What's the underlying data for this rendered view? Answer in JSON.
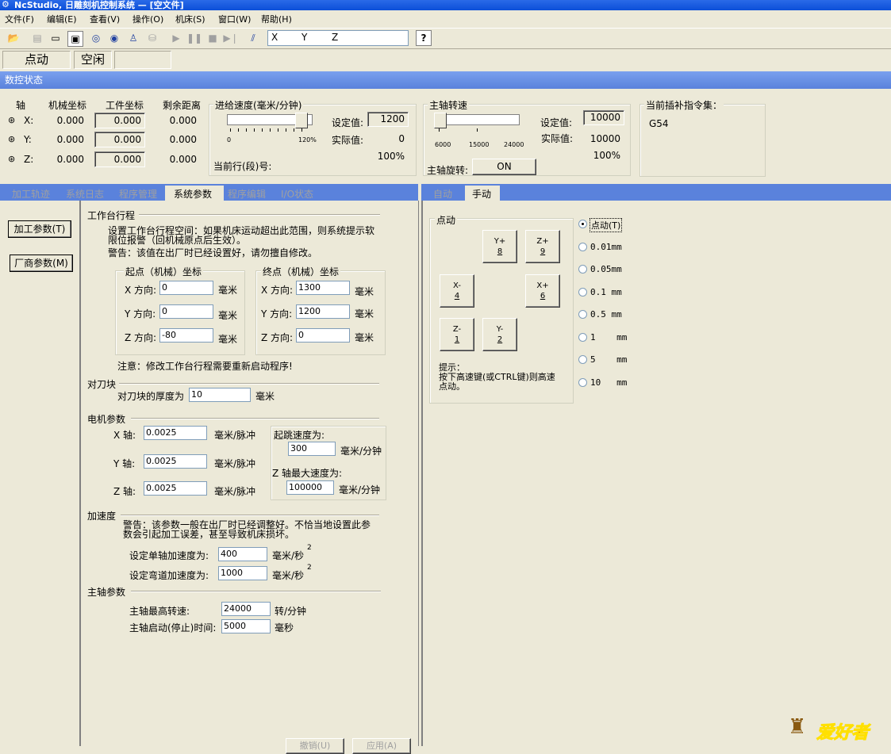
{
  "window": {
    "title": "NcStudio, 日雕刻机控制系统 — [空文件]"
  },
  "menu": [
    "文件(F)",
    "编辑(E)",
    "查看(V)",
    "操作(O)",
    "机床(S)",
    "窗口(W)",
    "帮助(H)"
  ],
  "toolbar": {
    "coord_labels": [
      "X",
      "Y",
      "Z"
    ],
    "help_label": "?"
  },
  "status": {
    "mode": "点动",
    "state": "空闲",
    "extra": ""
  },
  "nc_status": {
    "title": "数控状态"
  },
  "coords": {
    "headers": [
      "轴",
      "机械坐标",
      "工件坐标",
      "剩余距离"
    ],
    "rows": [
      {
        "axis": "X:",
        "machine": "0.000",
        "work": "0.000",
        "remain": "0.000"
      },
      {
        "axis": "Y:",
        "machine": "0.000",
        "work": "0.000",
        "remain": "0.000"
      },
      {
        "axis": "Z:",
        "machine": "0.000",
        "work": "0.000",
        "remain": "0.000"
      }
    ]
  },
  "feed": {
    "title": "进给速度(毫米/分钟)",
    "scale_min": "0",
    "scale_max": "120%",
    "set_label": "设定值:",
    "set_value": "1200",
    "actual_label": "实际值:",
    "actual_value": "0",
    "percent": "100%",
    "line_label": "当前行(段)号:",
    "slider_fraction": 0.8
  },
  "spindle": {
    "title": "主轴转速",
    "scale": [
      "6000",
      "15000",
      "24000"
    ],
    "set_label": "设定值:",
    "set_value": "10000",
    "actual_label": "实际值:",
    "actual_value": "10000",
    "percent": "100%",
    "rotate_label": "主轴旋转:",
    "rotate_button": "ON",
    "slider_fraction": 0.0
  },
  "gcode": {
    "title": "当前插补指令集：",
    "value": "G54"
  },
  "left_tabs": [
    "加工轨迹",
    "系统日志",
    "程序管理",
    "系统参数",
    "程序编辑",
    "I/O状态"
  ],
  "left_tab_active": 3,
  "side_buttons": [
    "加工参数(T)",
    "厂商参数(M)"
  ],
  "params": {
    "travel": {
      "title": "工作台行程",
      "desc": "设置工作台行程空间：如果机床运动超出此范围，则系统提示软限位报警（回机械原点后生效）。",
      "warn": "警告：该值在出厂时已经设置好，请勿擅自修改。",
      "start_title": "起点（机械）坐标",
      "end_title": "终点（机械）坐标",
      "x_label": "X 方向:",
      "y_label": "Y 方向:",
      "z_label": "Z 方向:",
      "unit": "毫米",
      "start": {
        "x": "0",
        "y": "0",
        "z": "-80"
      },
      "end": {
        "x": "1300",
        "y": "1200",
        "z": "0"
      },
      "note": "注意：修改工作台行程需要重新启动程序!"
    },
    "tool": {
      "title": "对刀块",
      "label": "对刀块的厚度为",
      "value": "10",
      "unit": "毫米"
    },
    "motor": {
      "title": "电机参数",
      "x_label": "X 轴:",
      "y_label": "Y 轴:",
      "z_label": "Z 轴:",
      "x": "0.0025",
      "y": "0.0025",
      "z": "0.0025",
      "unit": "毫米/脉冲",
      "jump_label": "起跳速度为:",
      "jump_value": "300",
      "jump_unit": "毫米/分钟",
      "zmax_label": "Z 轴最大速度为:",
      "zmax_value": "100000",
      "zmax_unit": "毫米/分钟"
    },
    "accel": {
      "title": "加速度",
      "warn": "警告：该参数一般在出厂时已经调整好。不恰当地设置此参数会引起加工误差，甚至导致机床损坏。",
      "single_label": "设定单轴加速度为:",
      "single_value": "400",
      "curve_label": "设定弯道加速度为:",
      "curve_value": "1000",
      "unit": "毫米/秒",
      "sup": "2"
    },
    "spindle": {
      "title": "主轴参数",
      "max_label": "主轴最高转速:",
      "max_value": "24000",
      "max_unit": "转/分钟",
      "start_label": "主轴启动(停止)时间:",
      "start_value": "5000",
      "start_unit": "毫秒"
    },
    "bottom_buttons": [
      "撤销(U)",
      "应用(A)"
    ]
  },
  "right_tabs": [
    "自动",
    "手动"
  ],
  "jog": {
    "title": "点动",
    "buttons": [
      {
        "label": "Y+",
        "key": "8"
      },
      {
        "label": "Z+",
        "key": "9"
      },
      {
        "label": "X-",
        "key": "4"
      },
      {
        "label": "X+",
        "key": "6"
      },
      {
        "label": "Z-",
        "key": "1"
      },
      {
        "label": "Y-",
        "key": "2"
      }
    ],
    "hint1": "提示：",
    "hint2": "按下高速键(或CTRL键)则高速",
    "hint3": "点动。",
    "options": [
      "点动(T)",
      "0.01mm",
      "0.05mm",
      "0.1 mm",
      "0.5 mm",
      "1    mm",
      "5    mm",
      "10   mm"
    ],
    "selected": 0
  },
  "watermark": "爱好者"
}
